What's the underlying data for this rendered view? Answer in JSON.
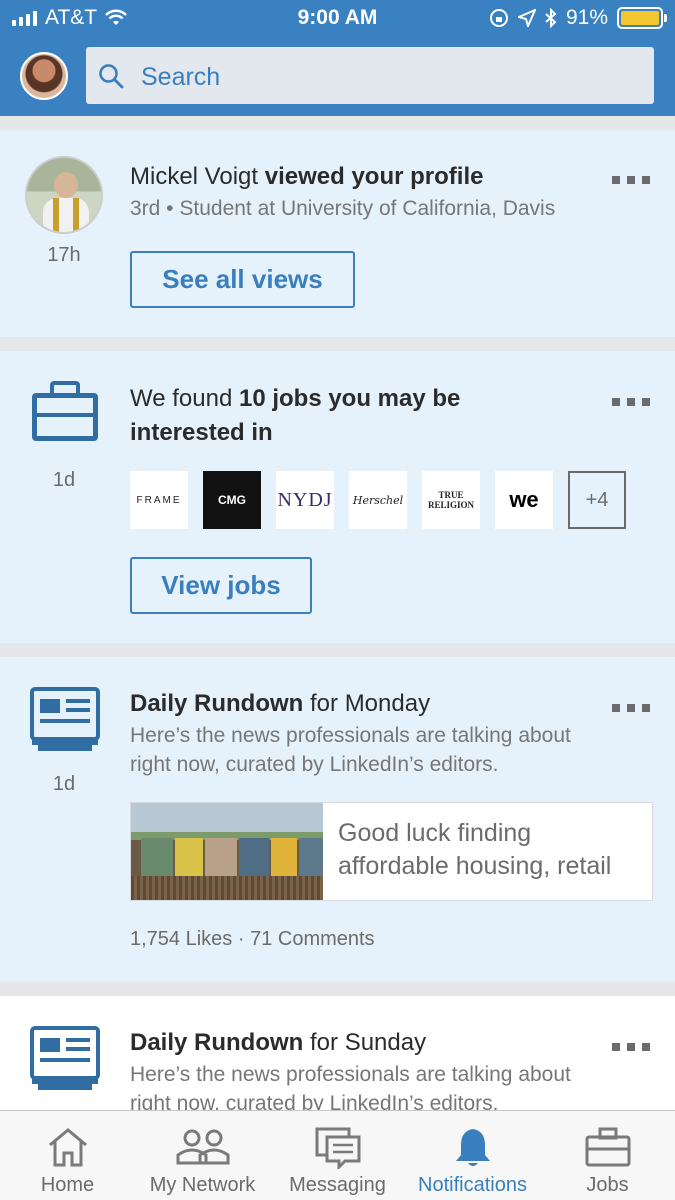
{
  "status_bar": {
    "carrier": "AT&T",
    "time": "9:00 AM",
    "battery": "91%"
  },
  "search": {
    "placeholder": "Search"
  },
  "notifications": [
    {
      "name": "Mickel Voigt",
      "action": "viewed your profile",
      "subtitle": "3rd • Student at University of California, Davis",
      "time": "17h",
      "button": "See all views"
    },
    {
      "text_prefix": "We found ",
      "text_bold": "10 jobs you may be interested in",
      "time": "1d",
      "logos": [
        "FRAME",
        "CMG",
        "NYDJ",
        "Herschel",
        "TRUE RELIGION",
        "we",
        "+4"
      ],
      "button": "View jobs"
    },
    {
      "title_bold": "Daily Rundown",
      "title_rest": " for Monday",
      "subtitle": "Here’s the news professionals are talking about right now, curated by LinkedIn’s editors.",
      "time": "1d",
      "article": "Good luck finding affordable housing, retail workers",
      "stats": "1,754 Likes · 71 Comments"
    },
    {
      "title_bold": "Daily Rundown",
      "title_rest": " for Sunday",
      "subtitle": "Here’s the news professionals are talking about right now, curated by LinkedIn’s editors."
    }
  ],
  "tabs": [
    {
      "label": "Home",
      "icon": "home-icon"
    },
    {
      "label": "My Network",
      "icon": "network-icon"
    },
    {
      "label": "Messaging",
      "icon": "messaging-icon"
    },
    {
      "label": "Notifications",
      "icon": "bell-icon",
      "active": true
    },
    {
      "label": "Jobs",
      "icon": "briefcase-icon"
    }
  ],
  "colors": {
    "brand": "#3a81c2",
    "accent": "#3a7fbd",
    "card_unread": "#e6f2fb",
    "battery": "#f5c530"
  }
}
